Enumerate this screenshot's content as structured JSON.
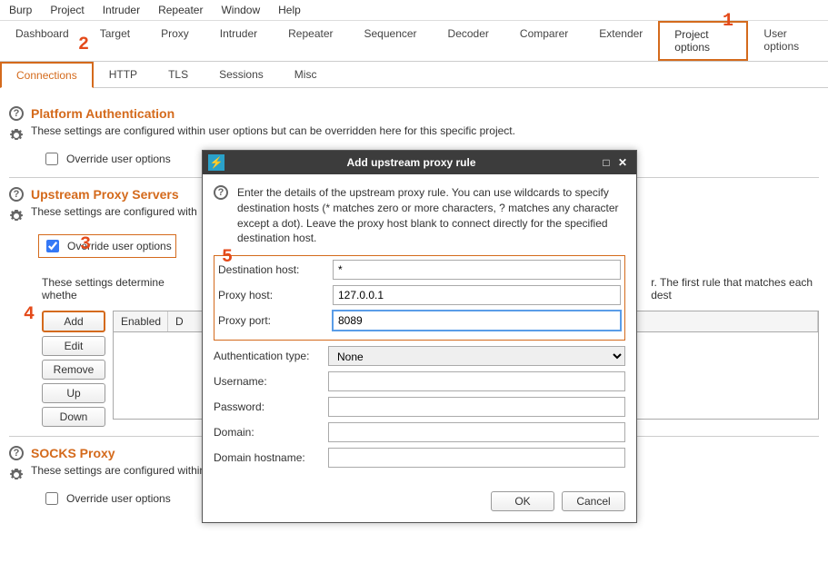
{
  "menubar": [
    "Burp",
    "Project",
    "Intruder",
    "Repeater",
    "Window",
    "Help"
  ],
  "tabs": [
    "Dashboard",
    "Target",
    "Proxy",
    "Intruder",
    "Repeater",
    "Sequencer",
    "Decoder",
    "Comparer",
    "Extender",
    "Project options",
    "User options"
  ],
  "subtabs": [
    "Connections",
    "HTTP",
    "TLS",
    "Sessions",
    "Misc"
  ],
  "callouts": {
    "c1": "1",
    "c2": "2",
    "c3": "3",
    "c4": "4",
    "c5": "5"
  },
  "section1": {
    "title": "Platform Authentication",
    "desc": "These settings are configured within user options but can be overridden here for this specific project.",
    "override": "Override user options"
  },
  "section2": {
    "title": "Upstream Proxy Servers",
    "desc": "These settings are configured with",
    "override": "Override user options",
    "determine": "These settings determine whethe",
    "determine_tail": "r. The first rule that matches each dest",
    "btns": {
      "add": "Add",
      "edit": "Edit",
      "remove": "Remove",
      "up": "Up",
      "down": "Down"
    },
    "tbl": {
      "enabled": "Enabled",
      "d": "D"
    }
  },
  "section3": {
    "title": "SOCKS Proxy",
    "desc": "These settings are configured within user options but can be overridden here for this specific project.",
    "override": "Override user options"
  },
  "dialog": {
    "title": "Add upstream proxy rule",
    "desc": "Enter the details of the upstream proxy rule. You can use wildcards to specify destination hosts (* matches zero or more characters, ? matches any character except a dot). Leave the proxy host blank to connect directly for the specified destination host.",
    "fields": {
      "dest_host": {
        "label": "Destination host:",
        "value": "*"
      },
      "proxy_host": {
        "label": "Proxy host:",
        "value": "127.0.0.1"
      },
      "proxy_port": {
        "label": "Proxy port:",
        "value": "8089"
      },
      "auth_type": {
        "label": "Authentication type:",
        "value": "None"
      },
      "username": {
        "label": "Username:",
        "value": ""
      },
      "password": {
        "label": "Password:",
        "value": ""
      },
      "domain": {
        "label": "Domain:",
        "value": ""
      },
      "domain_host": {
        "label": "Domain hostname:",
        "value": ""
      }
    },
    "ok": "OK",
    "cancel": "Cancel"
  }
}
